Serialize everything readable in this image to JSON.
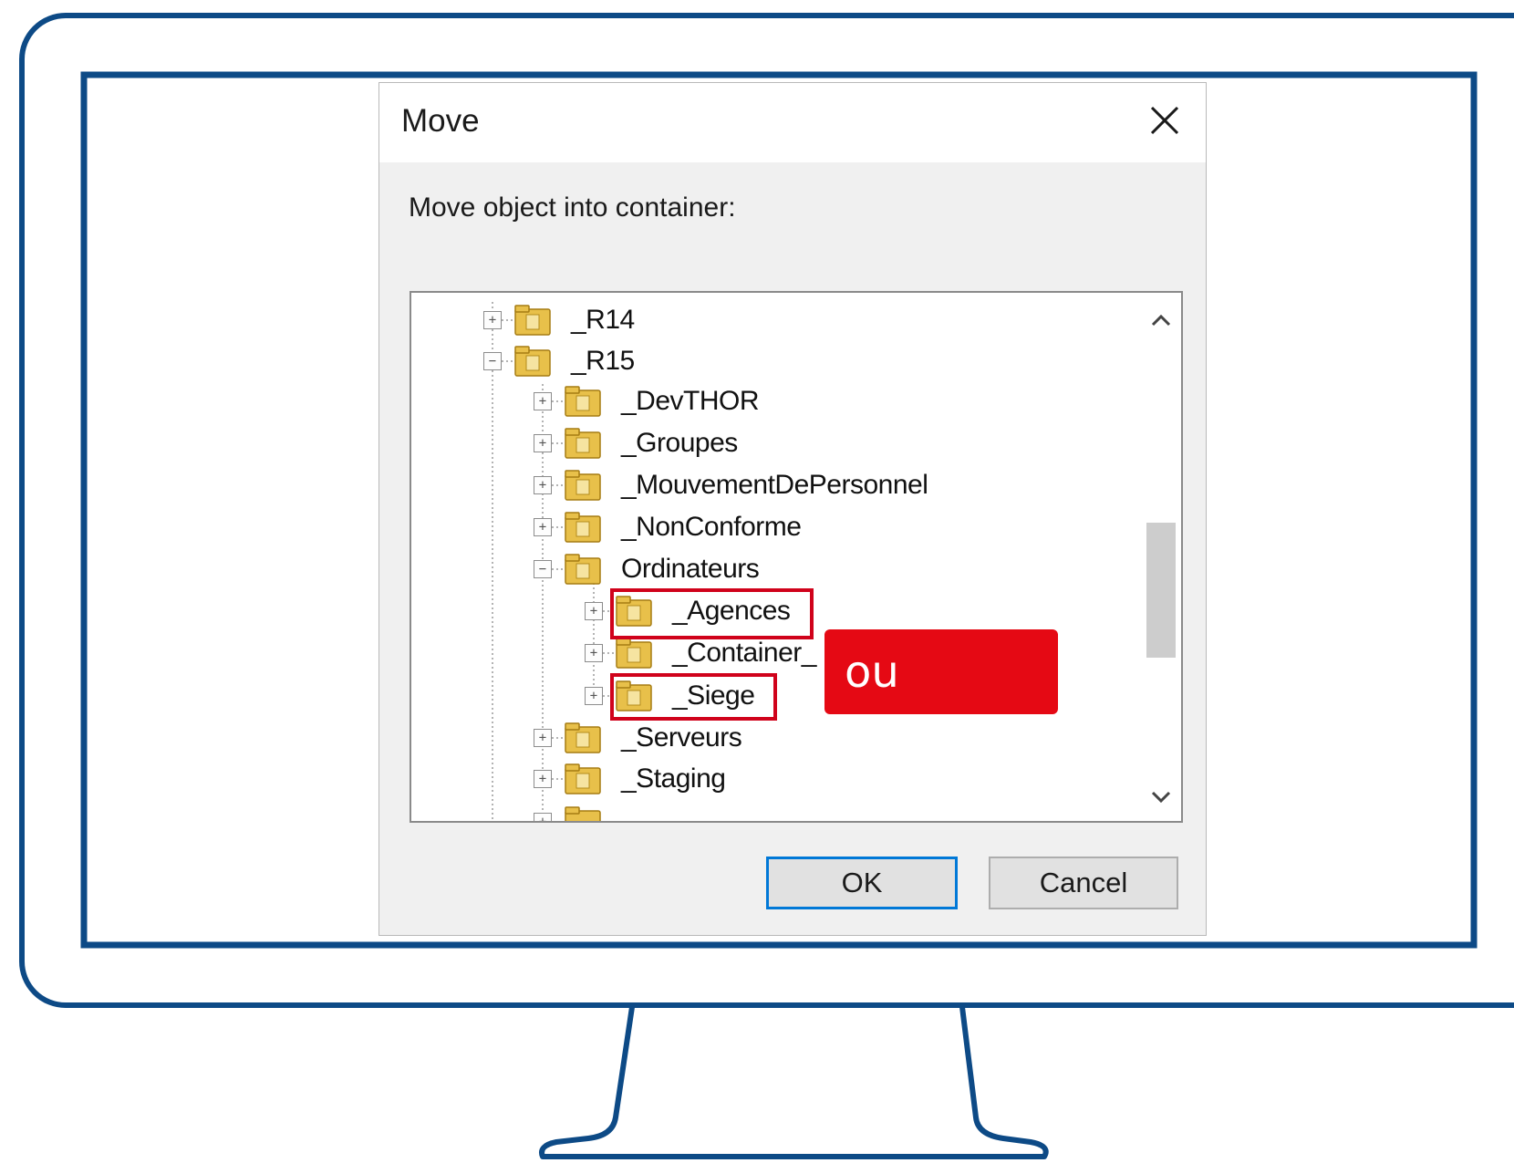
{
  "dialog": {
    "title": "Move",
    "close_icon": "close-icon",
    "prompt": "Move object into container:",
    "ok_label": "OK",
    "cancel_label": "Cancel"
  },
  "tree": {
    "items": [
      {
        "label": "_R14",
        "level": 0,
        "state": "collapsed"
      },
      {
        "label": "_R15",
        "level": 0,
        "state": "expanded"
      },
      {
        "label": "_DevTHOR",
        "level": 1,
        "state": "collapsed"
      },
      {
        "label": "_Groupes",
        "level": 1,
        "state": "collapsed"
      },
      {
        "label": "_MouvementDePersonnel",
        "level": 1,
        "state": "collapsed"
      },
      {
        "label": "_NonConforme",
        "level": 1,
        "state": "collapsed"
      },
      {
        "label": "Ordinateurs",
        "level": 1,
        "state": "expanded"
      },
      {
        "label": "_Agences",
        "level": 2,
        "state": "collapsed",
        "highlighted": true
      },
      {
        "label": "_Container_",
        "level": 2,
        "state": "collapsed"
      },
      {
        "label": "_Siege",
        "level": 2,
        "state": "collapsed",
        "highlighted": true
      },
      {
        "label": "_Serveurs",
        "level": 1,
        "state": "collapsed"
      },
      {
        "label": "_Staging",
        "level": 1,
        "state": "collapsed"
      }
    ]
  },
  "annotation": {
    "text": "ou",
    "color": "#e50914",
    "highlight_color": "#d0021b"
  },
  "colors": {
    "monitor_outline": "#0d4a86",
    "ok_focus": "#0078d7",
    "folder": "#e8c04a"
  }
}
